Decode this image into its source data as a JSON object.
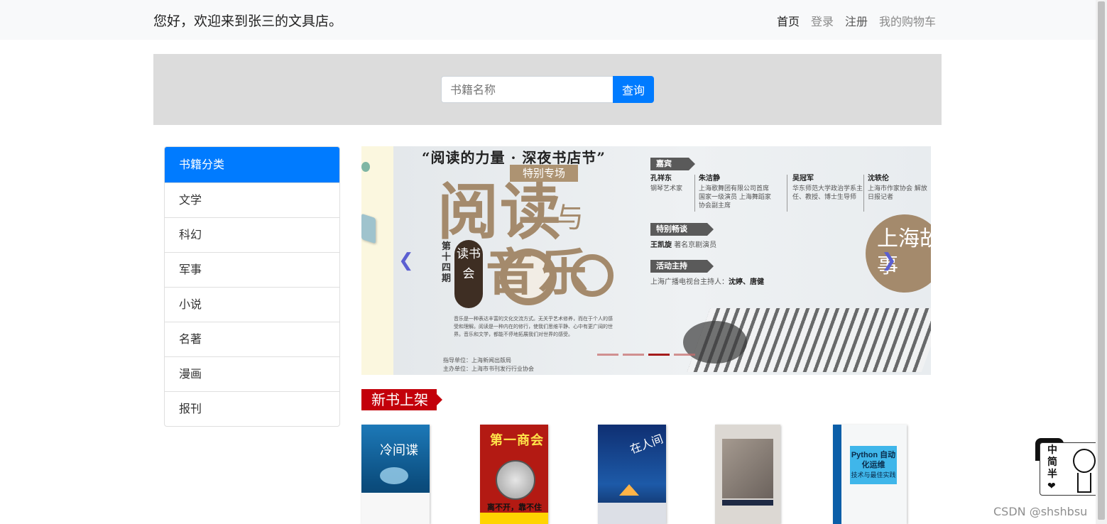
{
  "header": {
    "welcome": "您好，欢迎来到张三的文具店。",
    "nav": [
      "首页",
      "登录",
      "注册",
      "我的购物车"
    ]
  },
  "search": {
    "placeholder": "书籍名称",
    "button": "查询"
  },
  "categories": {
    "title": "书籍分类",
    "items": [
      "文学",
      "科幻",
      "军事",
      "小说",
      "名著",
      "漫画",
      "报刊"
    ]
  },
  "carousel": {
    "prev_icon": "chevron-left-icon",
    "next_icon": "chevron-right-icon",
    "indicator_count": 4,
    "active_index": 2,
    "slide": {
      "quote": "“阅读的力量 · 深夜书店节”",
      "special": "特别专场",
      "big1": "阅读",
      "big2": "与",
      "big3": "音乐",
      "issue": "第十四期",
      "seal": "读书会",
      "guests_tag": "嘉宾",
      "guests": [
        {
          "name": "孔祥东",
          "desc": "钢琴艺术家"
        },
        {
          "name": "朱洁静",
          "desc": "上海歌舞团有限公司首席 国家一级演员 上海舞蹈家协会副主席"
        },
        {
          "name": "吴冠军",
          "desc": "华东师范大学政治学系主任、教授、博士生导师"
        },
        {
          "name": "沈轶伦",
          "desc": "上海市作家协会 解放日报记者"
        }
      ],
      "talk_tag": "特别畅谈",
      "talk_name": "王凯旋",
      "talk_desc": "著名京剧演员",
      "host_tag": "活动主持",
      "host_prefix": "上海广播电视台主持人：",
      "host_names": "沈婷、唐健",
      "shanghai": "上海故事",
      "paragraph": "音乐是一种表达丰富的文化交流方式。无关乎艺术修养，而在于个人的感受和理解。阅读是一种内在的修行，使我们思维平静、心中有更广阔的世界。音乐和文学，都能不停地拓展我们对世界的感受。",
      "guide_unit": "指导单位：上海新闻出版局",
      "host_unit": "主办单位：上海市书刊发行行业协会"
    }
  },
  "new_books": {
    "title": "新书上架",
    "books": [
      {
        "cover_title": "冷间谍",
        "accent": "#1d79b8"
      },
      {
        "cover_title": "第一商会",
        "cover_sub": "离不开，靠不住",
        "accent": "#b31a13"
      },
      {
        "cover_title": "在人间",
        "accent": "#0f2f72"
      },
      {
        "accent": "#dcd8d3"
      },
      {
        "cover_title": "Python 自动化运维",
        "cover_sub": "技术与最佳实践",
        "accent": "#3fb6ea"
      }
    ]
  },
  "ime": {
    "chars": [
      "中",
      "简",
      "半",
      "❤"
    ]
  },
  "watermark": "CSDN @shshbsu",
  "colors": {
    "primary": "#007bff",
    "new_books_red": "#c3000a",
    "topbar_bg": "#f8f9fa",
    "search_band_bg": "#dcdcdc"
  }
}
